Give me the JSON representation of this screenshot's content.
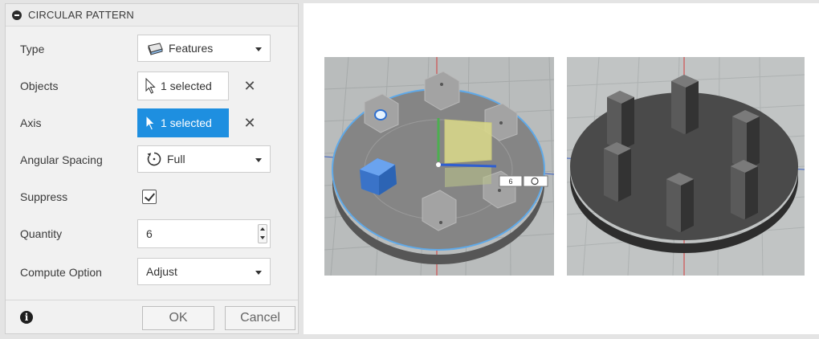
{
  "dialog": {
    "title": "CIRCULAR PATTERN",
    "fields": {
      "type": {
        "label": "Type",
        "value": "Features",
        "icon": "features-icon"
      },
      "objects": {
        "label": "Objects",
        "value": "1 selected",
        "icon": "cursor-arrow-icon"
      },
      "axis": {
        "label": "Axis",
        "value": "1 selected",
        "icon": "cursor-arrow-icon",
        "active": true
      },
      "angular_spacing": {
        "label": "Angular Spacing",
        "value": "Full",
        "icon": "full-rotation-icon"
      },
      "suppress": {
        "label": "Suppress",
        "checked": true
      },
      "quantity": {
        "label": "Quantity",
        "value": "6"
      },
      "compute_option": {
        "label": "Compute Option",
        "value": "Adjust"
      }
    },
    "footer": {
      "ok_label": "OK",
      "cancel_label": "Cancel",
      "info_icon": "info-icon"
    }
  },
  "viewport_left": {
    "manipulator_value": "6"
  },
  "colors": {
    "accent": "#1e8fe0",
    "selection_blue": "#3a78d0",
    "disc_gray": "#7f7f7f",
    "disc_dark": "#3d3d3d",
    "axis_red": "#d23a3a"
  }
}
